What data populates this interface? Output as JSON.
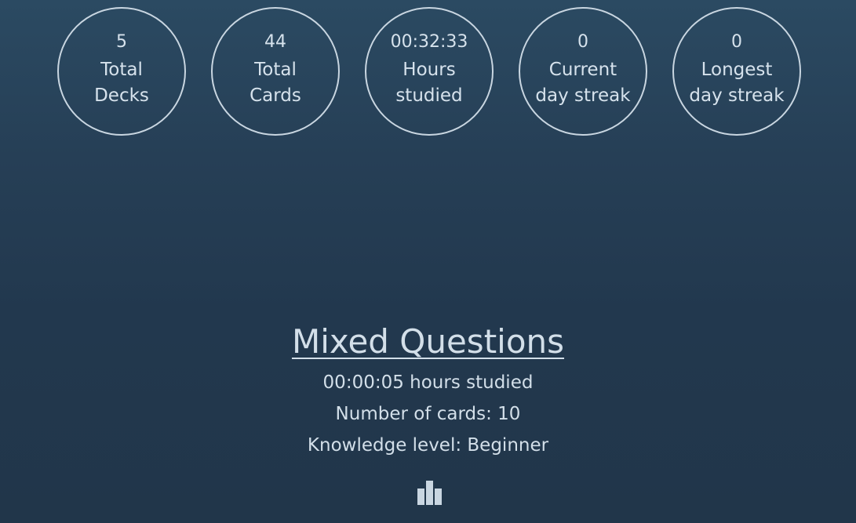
{
  "stats": [
    {
      "value": "5",
      "label_line1": "Total",
      "label_line2": "Decks"
    },
    {
      "value": "44",
      "label_line1": "Total",
      "label_line2": "Cards"
    },
    {
      "value": "00:32:33",
      "label_line1": "Hours",
      "label_line2": "studied"
    },
    {
      "value": "0",
      "label_line1": "Current",
      "label_line2": "day streak"
    },
    {
      "value": "0",
      "label_line1": "Longest",
      "label_line2": "day streak"
    }
  ],
  "deck": {
    "title": "Mixed Questions",
    "hours_studied": "00:00:05 hours studied",
    "card_count": "Number of cards: 10",
    "knowledge_level": "Knowledge level: Beginner",
    "stats_icon": "bar-chart-icon"
  },
  "colors": {
    "background_top": "#2b4a62",
    "background_bottom": "#21364a",
    "text": "#d6e2ec",
    "circle_border": "#c9d6e1"
  }
}
